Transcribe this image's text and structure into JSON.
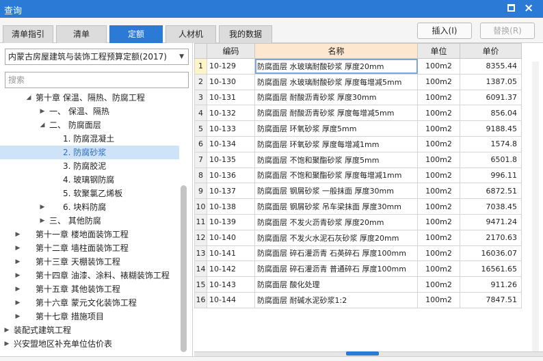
{
  "window": {
    "title": "查询"
  },
  "tabs": [
    {
      "label": "清单指引"
    },
    {
      "label": "清单"
    },
    {
      "label": "定额"
    },
    {
      "label": "人材机"
    },
    {
      "label": "我的数据"
    }
  ],
  "actions": {
    "insert_label": "插入(I)",
    "replace_label": "替换(R)"
  },
  "quota_library": {
    "selected": "内蒙古房屋建筑与装饰工程预算定额(2017)"
  },
  "search": {
    "placeholder": "搜索",
    "value": ""
  },
  "tree": [
    {
      "label": "第十章 保温、隔热、防腐工程",
      "expander": "expanded"
    },
    {
      "label": "一、 保温、隔热",
      "expander": "collapsed"
    },
    {
      "label": "二、 防腐面层",
      "expander": "expanded"
    },
    {
      "label": "1. 防腐混凝土",
      "expander": "none"
    },
    {
      "label": "2. 防腐砂浆",
      "expander": "none",
      "selected": true
    },
    {
      "label": "3. 防腐胶泥",
      "expander": "none"
    },
    {
      "label": "4. 玻璃钢防腐",
      "expander": "none"
    },
    {
      "label": "5. 软聚氯乙烯板",
      "expander": "none"
    },
    {
      "label": "6. 块料防腐",
      "expander": "collapsed"
    },
    {
      "label": "三、 其他防腐",
      "expander": "collapsed"
    },
    {
      "label": "第十一章 楼地面装饰工程",
      "expander": "collapsed"
    },
    {
      "label": "第十二章 墙柱面装饰工程",
      "expander": "collapsed"
    },
    {
      "label": "第十三章 天棚装饰工程",
      "expander": "collapsed"
    },
    {
      "label": "第十四章 油漆、涂料、裱糊装饰工程",
      "expander": "collapsed"
    },
    {
      "label": "第十五章 其他装饰工程",
      "expander": "collapsed"
    },
    {
      "label": "第十六章 蒙元文化装饰工程",
      "expander": "collapsed"
    },
    {
      "label": "第十七章 措施项目",
      "expander": "collapsed"
    },
    {
      "label": "装配式建筑工程",
      "expander": "collapsed"
    },
    {
      "label": "兴安盟地区补充单位估价表",
      "expander": "collapsed"
    }
  ],
  "table": {
    "columns": [
      "编码",
      "名称",
      "单位",
      "单价"
    ],
    "rows": [
      {
        "n": "1",
        "code": "10-129",
        "name": "防腐面层 水玻璃耐酸砂浆 厚度20mm",
        "unit": "100m2",
        "price": "8355.44"
      },
      {
        "n": "2",
        "code": "10-130",
        "name": "防腐面层 水玻璃耐酸砂浆 厚度每增减5mm",
        "unit": "100m2",
        "price": "1387.05"
      },
      {
        "n": "3",
        "code": "10-131",
        "name": "防腐面层 耐酸沥青砂浆 厚度30mm",
        "unit": "100m2",
        "price": "6091.37"
      },
      {
        "n": "4",
        "code": "10-132",
        "name": "防腐面层 耐酸沥青砂浆 厚度每增减5mm",
        "unit": "100m2",
        "price": "856.04"
      },
      {
        "n": "5",
        "code": "10-133",
        "name": "防腐面层 环氧砂浆 厚度5mm",
        "unit": "100m2",
        "price": "9188.45"
      },
      {
        "n": "6",
        "code": "10-134",
        "name": "防腐面层 环氧砂浆 厚度每增减1mm",
        "unit": "100m2",
        "price": "1574.8"
      },
      {
        "n": "7",
        "code": "10-135",
        "name": "防腐面层 不饱和聚酯砂浆 厚度5mm",
        "unit": "100m2",
        "price": "6501.8"
      },
      {
        "n": "8",
        "code": "10-136",
        "name": "防腐面层 不饱和聚酯砂浆 厚度每增减1mm",
        "unit": "100m2",
        "price": "996.11"
      },
      {
        "n": "9",
        "code": "10-137",
        "name": "防腐面层 钢屑砂浆 一般抹面 厚度30mm",
        "unit": "100m2",
        "price": "6872.51"
      },
      {
        "n": "10",
        "code": "10-138",
        "name": "防腐面层 钢屑砂浆 吊车梁抹面 厚度30mm",
        "unit": "100m2",
        "price": "7038.45"
      },
      {
        "n": "11",
        "code": "10-139",
        "name": "防腐面层 不发火沥青砂浆 厚度20mm",
        "unit": "100m2",
        "price": "9471.24"
      },
      {
        "n": "12",
        "code": "10-140",
        "name": "防腐面层 不发火水泥石灰砂浆 厚度20mm",
        "unit": "100m2",
        "price": "2170.63"
      },
      {
        "n": "13",
        "code": "10-141",
        "name": "防腐面层 碎石灌沥青 石英碎石 厚度100mm",
        "unit": "100m2",
        "price": "16036.07"
      },
      {
        "n": "14",
        "code": "10-142",
        "name": "防腐面层 碎石灌沥青 普通碎石 厚度100mm",
        "unit": "100m2",
        "price": "16561.65"
      },
      {
        "n": "15",
        "code": "10-143",
        "name": "防腐面层 酸化处理",
        "unit": "100m2",
        "price": "911.26"
      },
      {
        "n": "16",
        "code": "10-144",
        "name": "防腐面层 耐碱水泥砂浆1:2",
        "unit": "100m2",
        "price": "7847.51"
      }
    ]
  }
}
